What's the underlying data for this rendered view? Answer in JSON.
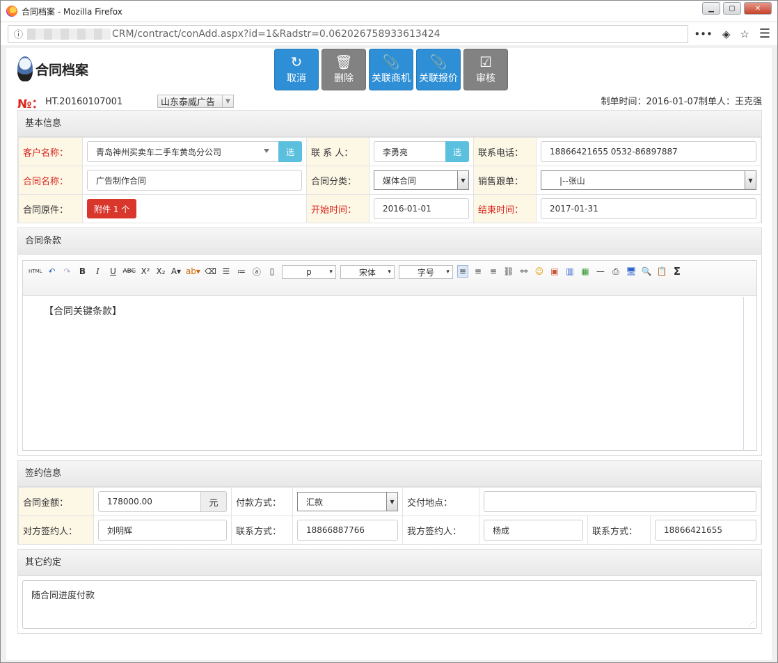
{
  "window": {
    "title": "合同档案 - Mozilla Firefox"
  },
  "browser": {
    "url": "CRM/contract/conAdd.aspx?id=1&Radstr=0.062026758933613424"
  },
  "header": {
    "logo_text": "合同档案"
  },
  "toolbar": {
    "buttons": [
      {
        "label": "取消",
        "icon": "undo-icon",
        "color": "#2e8fd6"
      },
      {
        "label": "删除",
        "icon": "trash-icon",
        "color": "#828282"
      },
      {
        "label": "关联商机",
        "icon": "paperclip-icon",
        "color": "#2e8fd6"
      },
      {
        "label": "关联报价",
        "icon": "paperclip-icon",
        "color": "#2e8fd6"
      },
      {
        "label": "审核",
        "icon": "check-square-icon",
        "color": "#828282"
      }
    ]
  },
  "doc": {
    "no_label": "№：",
    "no_value": "HT.20160107001",
    "company": "山东泰威广告",
    "meta": "制单时间：2016-01-07制单人：王克强"
  },
  "basic": {
    "title": "基本信息",
    "customer_label": "客户名称：",
    "customer_value": "青岛神州买卖车二手车黄岛分公司",
    "select_btn": "选",
    "contact_label": "联 系 人：",
    "contact_value": "李勇亮",
    "phone_label": "联系电话：",
    "phone_value": "18866421655 0532-86897887",
    "name_label": "合同名称：",
    "name_value": "广告制作合同",
    "category_label": "合同分类：",
    "category_value": "媒体合同",
    "sales_label": "销售跟单：",
    "sales_value": "|--张山",
    "attach_label": "合同原件：",
    "attach_btn": "附件 1 个",
    "start_label": "开始时间：",
    "start_value": "2016-01-01",
    "end_label": "结束时间：",
    "end_value": "2017-01-31"
  },
  "terms": {
    "title": "合同条款",
    "editor_para": "p",
    "editor_font": "宋体",
    "editor_size": "字号",
    "html_btn": "HTML",
    "content": "【合同关键条款】"
  },
  "sign": {
    "title": "签约信息",
    "amount_label": "合同金额：",
    "amount_value": "178000.00",
    "amount_unit": "元",
    "pay_label": "付款方式：",
    "pay_value": "汇款",
    "place_label": "交付地点：",
    "place_value": "",
    "their_label": "对方签约人：",
    "their_value": "刘明辉",
    "their_contact_label": "联系方式：",
    "their_contact_value": "18866887766",
    "our_label": "我方签约人：",
    "our_value": "杨成",
    "our_contact_label": "联系方式：",
    "our_contact_value": "18866421655"
  },
  "other": {
    "title": "其它约定",
    "content": "随合同进度付款"
  }
}
